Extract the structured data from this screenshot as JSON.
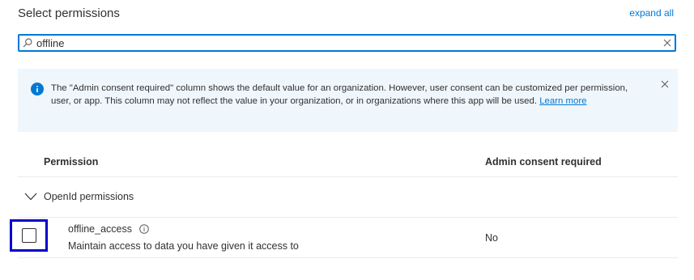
{
  "header": {
    "title": "Select permissions",
    "expand_all": "expand all"
  },
  "search": {
    "value": "offline",
    "icon": "search-icon",
    "clear_icon": "close-icon"
  },
  "banner": {
    "icon": "info-icon",
    "text": "The \"Admin consent required\" column shows the default value for an organization. However, user consent can be customized per permission, user, or app. This column may not reflect the value in your organization, or in organizations where this app will be used.",
    "link_text": "Learn more",
    "close_icon": "close-icon",
    "background": "#eff6fc"
  },
  "table": {
    "columns": [
      "Permission",
      "Admin consent required"
    ],
    "groups": [
      {
        "label": "OpenId permissions",
        "expanded": true,
        "rows": [
          {
            "name": "offline_access",
            "description": "Maintain access to data you have given it access to",
            "admin_consent": "No",
            "checked": false
          }
        ]
      }
    ]
  },
  "colors": {
    "accent": "#0078d4",
    "focus_outline": "#0000cc"
  }
}
